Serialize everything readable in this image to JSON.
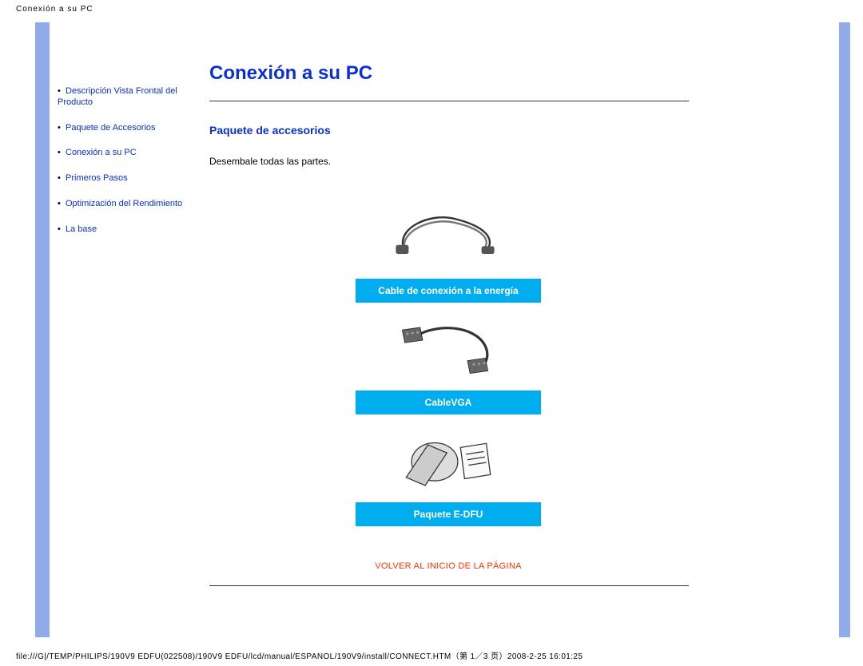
{
  "doc_title_top": "Conexión a su PC",
  "sidebar": {
    "items": [
      {
        "label": "Descripción Vista Frontal del Producto"
      },
      {
        "label": "Paquete de Accesorios"
      },
      {
        "label": "Conexión a su PC"
      },
      {
        "label": "Primeros Pasos"
      },
      {
        "label": "Optimización del Rendimiento"
      },
      {
        "label": "La base"
      }
    ]
  },
  "main": {
    "heading": "Conexión a su PC",
    "section_title": "Paquete de accesorios",
    "instruction": "Desembale todas las partes.",
    "accessories": [
      {
        "caption": "Cable de conexión a la energía",
        "icon": "power-cable-icon"
      },
      {
        "caption": "CableVGA",
        "icon": "vga-cable-icon"
      },
      {
        "caption": "Paquete E-DFU",
        "icon": "edfu-pack-icon"
      }
    ],
    "back_to_top": "VOLVER AL INICIO DE LA PÁGINA"
  },
  "footer_path": "file:///G|/TEMP/PHILIPS/190V9 EDFU(022508)/190V9 EDFU/lcd/manual/ESPANOL/190V9/install/CONNECT.HTM（第 1／3 页）2008-2-25 16:01:25"
}
